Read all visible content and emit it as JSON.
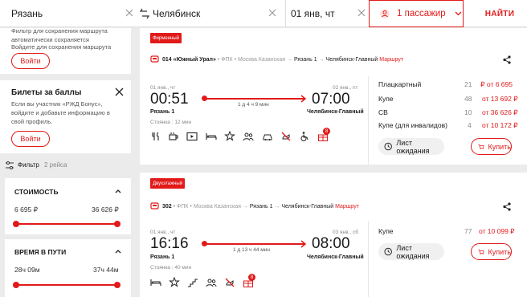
{
  "search": {
    "from": "Рязань",
    "to": "Челябинск",
    "date": "01 янв, чт",
    "passengers": "1 пассажир",
    "find": "НАЙТИ"
  },
  "save_route": {
    "text": "Фильтр для сохранения маршрута автоматически сохраняется",
    "hint": "Войдите для сохранения маршрута",
    "login": "Войти"
  },
  "bonus": {
    "title": "Билеты за баллы",
    "text": "Если вы участник «РЖД Бонус», войдите и добавьте информацию в свой профиль.",
    "login": "Войти"
  },
  "filter": {
    "label": "Фильтр",
    "count": "2 рейса"
  },
  "price_filter": {
    "title": "СТОИМОСТЬ",
    "min": "6 695 ₽",
    "max": "36 626 ₽"
  },
  "time_filter": {
    "title": "ВРЕМЯ В ПУТИ",
    "min": "28ч 09м",
    "max": "37ч 44м"
  },
  "trains": [
    {
      "tag": "Фирменный",
      "number": "014 «Южный Урал»",
      "carrier": "ФПК",
      "origin": "Москва Казанская",
      "seg_from": "Рязань 1",
      "seg_to": "Челябинск-Главный",
      "route": "Маршрут",
      "dep_date": "01 янв., чт",
      "dep": "00:51",
      "arr_date": "02 янв., пт",
      "arr": "07:00",
      "duration": "1 д 4 ч 9 мин",
      "from": "Рязань 1",
      "to": "Челябинск-Главный",
      "stop": "Стоянка : 12 мин",
      "badge": "8",
      "classes": [
        {
          "name": "Плацкартный",
          "seats": "21",
          "price": "от 6 695 ₽"
        },
        {
          "name": "Купе",
          "seats": "48",
          "price": "от 13 692 ₽"
        },
        {
          "name": "СВ",
          "seats": "10",
          "price": "от 36 626 ₽"
        },
        {
          "name": "Купе (для инвалидов)",
          "seats": "4",
          "price": "от 10 172 ₽"
        }
      ],
      "wait": "Лист ожидания",
      "buy": "Купить"
    },
    {
      "tag": "Двухэтажный",
      "number": "302",
      "carrier": "ФПК",
      "origin": "Москва Казанская",
      "seg_from": "Рязань 1",
      "seg_to": "Челябинск-Главный",
      "route": "Маршрут",
      "dep_date": "01 янв., чт",
      "dep": "16:16",
      "arr_date": "03 янв., сб",
      "arr": "08:00",
      "duration": "1 д 13 ч 44 мин",
      "from": "Рязань 1",
      "to": "Челябинск-Главный",
      "stop": "Стоянка : 40 мин",
      "badge": "8",
      "classes": [
        {
          "name": "Купе",
          "seats": "77",
          "price": "от 10 099 ₽"
        }
      ],
      "wait": "Лист ожидания",
      "buy": "Купить"
    }
  ],
  "colors": {
    "accent": "#e21a1a",
    "bg": "#ebebeb"
  }
}
